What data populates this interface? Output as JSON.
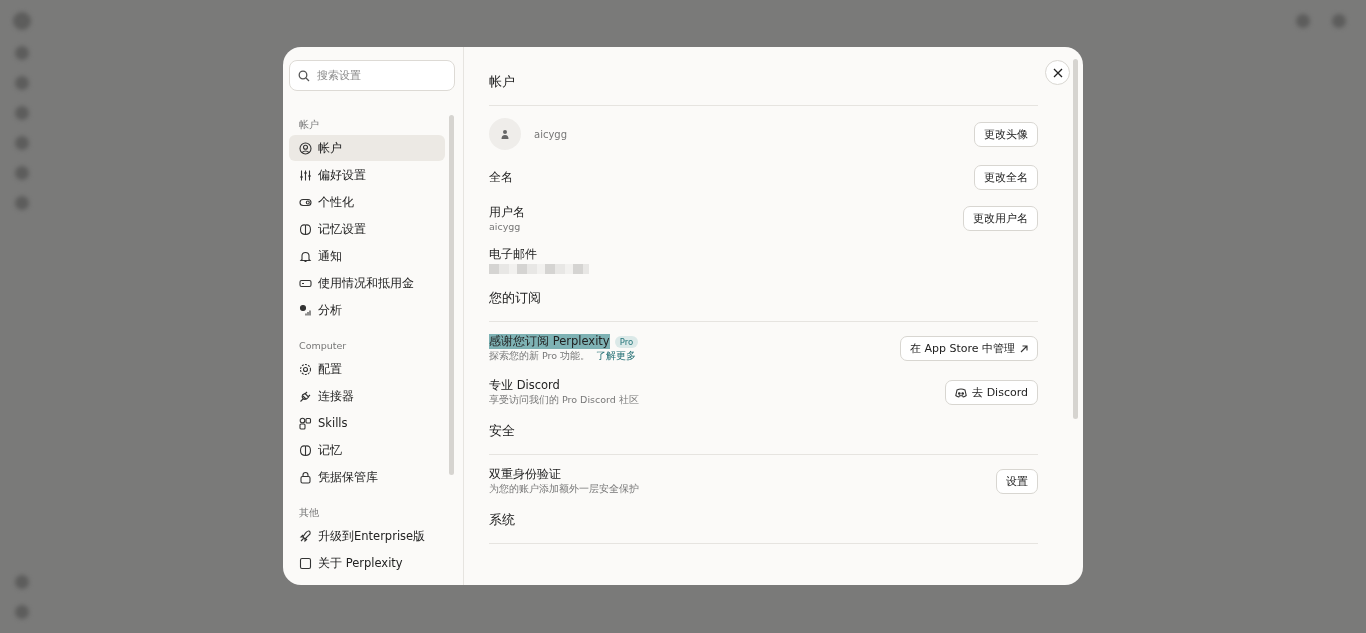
{
  "search": {
    "placeholder": "搜索设置"
  },
  "sidebar": {
    "sections": [
      {
        "title": "帐户",
        "items": [
          {
            "label": "帐户",
            "selected": true
          },
          {
            "label": "偏好设置",
            "selected": false
          },
          {
            "label": "个性化",
            "selected": false
          },
          {
            "label": "记忆设置",
            "selected": false
          },
          {
            "label": "通知",
            "selected": false
          },
          {
            "label": "使用情况和抵用金",
            "selected": false
          },
          {
            "label": "分析",
            "selected": false
          }
        ]
      },
      {
        "title": "Computer",
        "items": [
          {
            "label": "配置",
            "selected": false
          },
          {
            "label": "连接器",
            "selected": false
          },
          {
            "label": "Skills",
            "selected": false
          },
          {
            "label": "记忆",
            "selected": false
          },
          {
            "label": "凭据保管库",
            "selected": false
          }
        ]
      },
      {
        "title": "其他",
        "items": [
          {
            "label": "升级到Enterprise版",
            "selected": false
          },
          {
            "label": "关于 Perplexity",
            "selected": false
          }
        ]
      }
    ]
  },
  "sections": [
    {
      "title": "帐户",
      "rows": [
        {
          "kind": "avatar",
          "value": "aicygg",
          "button": {
            "label": "更改头像",
            "kind": "plain"
          }
        },
        {
          "kind": "field",
          "label": "全名",
          "button": {
            "label": "更改全名",
            "kind": "plain"
          }
        },
        {
          "kind": "field",
          "label": "用户名",
          "value": "aicygg",
          "button": {
            "label": "更改用户名",
            "kind": "plain"
          }
        },
        {
          "kind": "redacted",
          "label": "电子邮件"
        }
      ]
    },
    {
      "title": "您的订阅",
      "rows": [
        {
          "kind": "field",
          "label": "感谢您订阅 Perplexity",
          "highlighted": true,
          "badge": "Pro",
          "value": "探索您的新 Pro 功能。",
          "link": "了解更多",
          "button": {
            "label": "在 App Store 中管理",
            "kind": "external"
          }
        },
        {
          "kind": "field",
          "label": "专业 Discord",
          "value": "享受访问我们的 Pro Discord 社区",
          "button": {
            "label": "去 Discord",
            "kind": "discord"
          }
        }
      ]
    },
    {
      "title": "安全",
      "rows": [
        {
          "kind": "field",
          "label": "双重身份验证",
          "value": "为您的账户添加额外一层安全保护",
          "button": {
            "label": "设置",
            "kind": "plain"
          }
        }
      ]
    },
    {
      "title": "系统"
    }
  ]
}
